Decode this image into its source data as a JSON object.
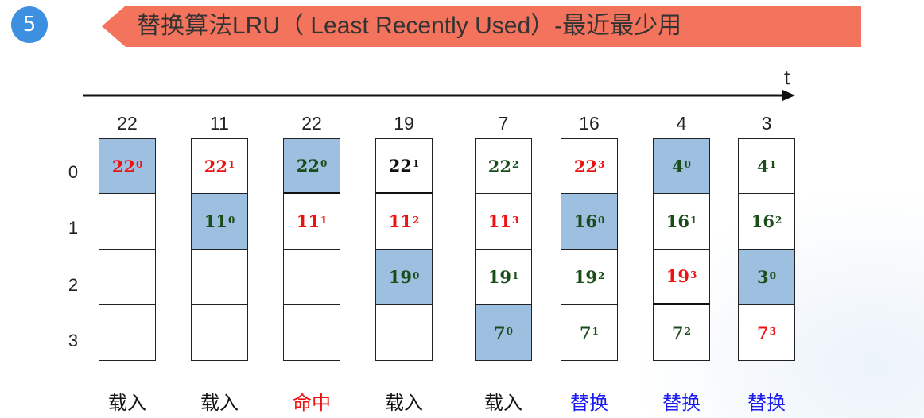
{
  "badge": "5",
  "title": "替换算法LRU（  Least Recently Used）-最近最少用",
  "time_axis_label": "t",
  "row_labels": [
    "0",
    "1",
    "2",
    "3"
  ],
  "colors": {
    "red": "#ee1111",
    "green": "#1b4d1b",
    "black": "#111111",
    "blue": "#1a1aee",
    "highlight": "#9dbfe0",
    "banner": "#f4735c",
    "badge": "#3d8fe0"
  },
  "columns": [
    {
      "access": "22",
      "action": "载入",
      "action_color": "black",
      "cells": [
        {
          "v": "22",
          "s": "0",
          "color": "red",
          "hl": true
        },
        {
          "v": "",
          "s": "",
          "color": "black",
          "hl": false
        },
        {
          "v": "",
          "s": "",
          "color": "black",
          "hl": false
        },
        {
          "v": "",
          "s": "",
          "color": "black",
          "hl": false
        }
      ]
    },
    {
      "access": "11",
      "action": "载入",
      "action_color": "black",
      "cells": [
        {
          "v": "22",
          "s": "1",
          "color": "red",
          "hl": false
        },
        {
          "v": "11",
          "s": "0",
          "color": "green",
          "hl": true
        },
        {
          "v": "",
          "s": "",
          "color": "black",
          "hl": false
        },
        {
          "v": "",
          "s": "",
          "color": "black",
          "hl": false
        }
      ]
    },
    {
      "access": "22",
      "action": "命中",
      "action_color": "red",
      "cells": [
        {
          "v": "22",
          "s": "0",
          "color": "green",
          "hl": true,
          "thick": true
        },
        {
          "v": "11",
          "s": "1",
          "color": "red",
          "hl": false
        },
        {
          "v": "",
          "s": "",
          "color": "black",
          "hl": false
        },
        {
          "v": "",
          "s": "",
          "color": "black",
          "hl": false
        }
      ]
    },
    {
      "access": "19",
      "action": "载入",
      "action_color": "black",
      "cells": [
        {
          "v": "22",
          "s": "1",
          "color": "black",
          "hl": false,
          "thick": true
        },
        {
          "v": "11",
          "s": "2",
          "color": "red",
          "hl": false
        },
        {
          "v": "19",
          "s": "0",
          "color": "green",
          "hl": true
        },
        {
          "v": "",
          "s": "",
          "color": "black",
          "hl": false
        }
      ]
    },
    {
      "access": "7",
      "action": "载入",
      "action_color": "black",
      "cells": [
        {
          "v": "22",
          "s": "2",
          "color": "green",
          "hl": false
        },
        {
          "v": "11",
          "s": "3",
          "color": "red",
          "hl": false
        },
        {
          "v": "19",
          "s": "1",
          "color": "green",
          "hl": false
        },
        {
          "v": "7",
          "s": "0",
          "color": "green",
          "hl": true
        }
      ]
    },
    {
      "access": "16",
      "action": "替换",
      "action_color": "blue",
      "cells": [
        {
          "v": "22",
          "s": "3",
          "color": "red",
          "hl": false
        },
        {
          "v": "16",
          "s": "0",
          "color": "green",
          "hl": true
        },
        {
          "v": "19",
          "s": "2",
          "color": "green",
          "hl": false
        },
        {
          "v": "7",
          "s": "1",
          "color": "green",
          "hl": false
        }
      ]
    },
    {
      "access": "4",
      "action": "替换",
      "action_color": "blue",
      "cells": [
        {
          "v": "4",
          "s": "0",
          "color": "green",
          "hl": true
        },
        {
          "v": "16",
          "s": "1",
          "color": "green",
          "hl": false
        },
        {
          "v": "19",
          "s": "3",
          "color": "red",
          "hl": false,
          "thick": true
        },
        {
          "v": "7",
          "s": "2",
          "color": "green",
          "hl": false
        }
      ]
    },
    {
      "access": "3",
      "action": "替换",
      "action_color": "blue",
      "cells": [
        {
          "v": "4",
          "s": "1",
          "color": "green",
          "hl": false
        },
        {
          "v": "16",
          "s": "2",
          "color": "green",
          "hl": false
        },
        {
          "v": "3",
          "s": "0",
          "color": "green",
          "hl": true
        },
        {
          "v": "7",
          "s": "3",
          "color": "red",
          "hl": false
        }
      ]
    }
  ]
}
